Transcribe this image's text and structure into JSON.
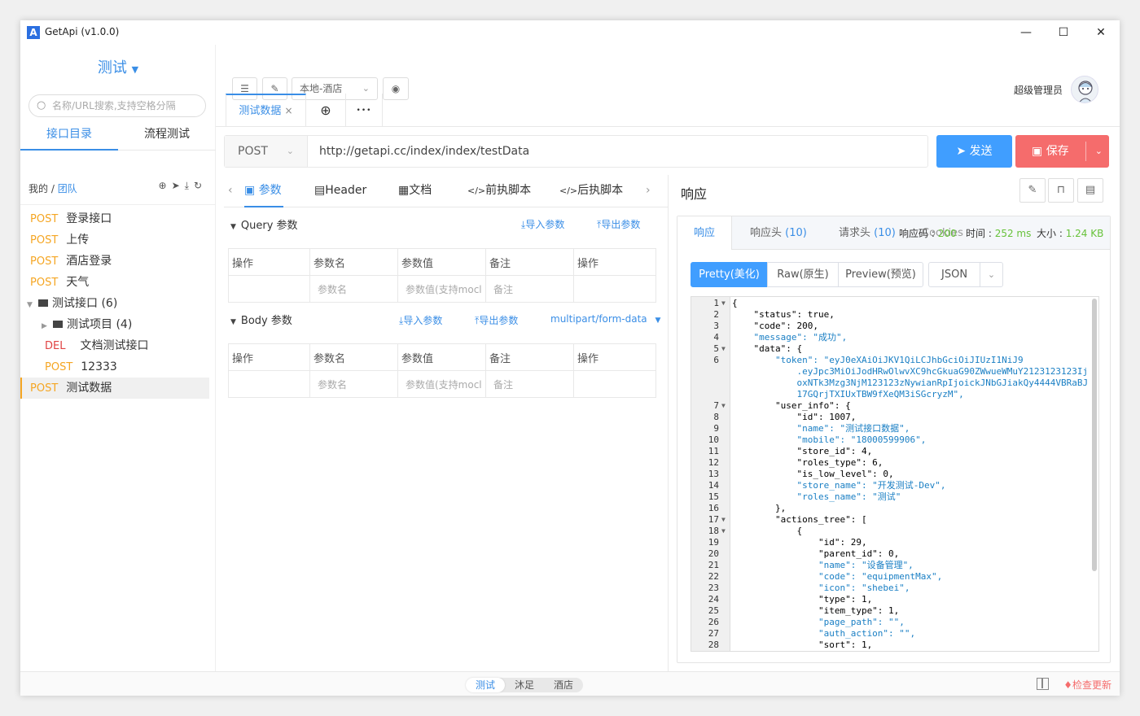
{
  "window": {
    "title": "GetApi (v1.0.0)",
    "logo": "A",
    "min": "—",
    "max": "☐",
    "close": "✕"
  },
  "sidebar": {
    "project": "测试",
    "search_placeholder": "名称/URL搜索,支持空格分隔",
    "tabs": [
      "接口目录",
      "流程测试"
    ],
    "breadcrumb_mine": "我的",
    "breadcrumb_sep": " / ",
    "breadcrumb_team": "团队",
    "items": [
      {
        "method": "POST",
        "name": "登录接口"
      },
      {
        "method": "POST",
        "name": "上传"
      },
      {
        "method": "POST",
        "name": "酒店登录"
      },
      {
        "method": "POST",
        "name": "天气"
      },
      {
        "folder": "测试接口 (6)"
      },
      {
        "folder": "测试项目 (4)"
      },
      {
        "method": "DEL",
        "name": "文档测试接口"
      },
      {
        "method": "POST",
        "name": "12333"
      },
      {
        "method": "POST",
        "name": "测试数据"
      }
    ]
  },
  "toolbar": {
    "env_select": "本地-酒店",
    "user": "超级管理员"
  },
  "tabs": {
    "active": "测试数据",
    "close": "×",
    "add": "⊕",
    "more": "•••"
  },
  "request": {
    "method": "POST",
    "url": "http://getapi.cc/index/index/testData",
    "send": "发送",
    "save": "保存"
  },
  "param_tabs": [
    "参数",
    "Header",
    "文档",
    "前执脚本",
    "后执脚本"
  ],
  "query": {
    "title": "Query 参数",
    "import": "导入参数",
    "export": "导出参数",
    "headers": [
      "操作",
      "参数名",
      "参数值",
      "备注",
      "操作"
    ],
    "placeholders": [
      "参数名",
      "参数值(支持mocl",
      "备注"
    ]
  },
  "body": {
    "title": "Body 参数",
    "import": "导入参数",
    "export": "导出参数",
    "content_type": "multipart/form-data",
    "headers": [
      "操作",
      "参数名",
      "参数值",
      "备注",
      "操作"
    ],
    "placeholders": [
      "参数名",
      "参数值(支持mocl",
      "备注"
    ]
  },
  "response": {
    "title": "响应",
    "tabs": {
      "resp": "响应",
      "resp_headers": "响应头",
      "resp_headers_count": "(10)",
      "req_headers": "请求头",
      "req_headers_count": "(10)",
      "cookies": "Cookies",
      "code_label": "响应码 :",
      "code": "200",
      "time_label": "时间 :",
      "time": "252 ms",
      "size_label": "大小 :",
      "size": "1.24 KB"
    },
    "formats": [
      "Pretty(美化)",
      "Raw(原生)",
      "Preview(预览)",
      "JSON"
    ],
    "lines": [
      "{",
      "    \"status\": true,",
      "    \"code\": 200,",
      "    \"message\": \"成功\",",
      "    \"data\": {",
      "        \"token\": \"eyJ0eXAiOiJKV1QiLCJhbGciOiJIUzI1NiJ9",
      "            .eyJpc3MiOiJodHRwOlwvXC9hcGkuaG90ZWwueWMuY2123123123Ij",
      "            oxNTk3Mzg3NjM123123zNywianRpIjoickJNbGJiakQy4444VBRaBJ",
      "            17GQrjTXIUxTBW9fXeQM3iSGcryzM\",",
      "        \"user_info\": {",
      "            \"id\": 1007,",
      "            \"name\": \"测试接口数据\",",
      "            \"mobile\": \"18000599906\",",
      "            \"store_id\": 4,",
      "            \"roles_type\": 6,",
      "            \"is_low_level\": 0,",
      "            \"store_name\": \"开发测试-Dev\",",
      "            \"roles_name\": \"测试\"",
      "        },",
      "        \"actions_tree\": [",
      "            {",
      "                \"id\": 29,",
      "                \"parent_id\": 0,",
      "                \"name\": \"设备管理\",",
      "                \"code\": \"equipmentMax\",",
      "                \"icon\": \"shebei\",",
      "                \"type\": 1,",
      "                \"item_type\": 1,",
      "                \"page_path\": \"\",",
      "                \"auth_action\": \"\",",
      "                \"sort\": 1,"
    ],
    "line_numbers": [
      "1",
      "2",
      "3",
      "4",
      "5",
      "6",
      "",
      "",
      "",
      "7",
      "8",
      "9",
      "10",
      "11",
      "12",
      "13",
      "14",
      "15",
      "16",
      "17",
      "18",
      "19",
      "20",
      "21",
      "22",
      "23",
      "24",
      "25",
      "26",
      "27",
      "28"
    ]
  },
  "status_bar": {
    "envs": [
      "测试",
      "沐足",
      "酒店"
    ],
    "update": "检查更新"
  }
}
